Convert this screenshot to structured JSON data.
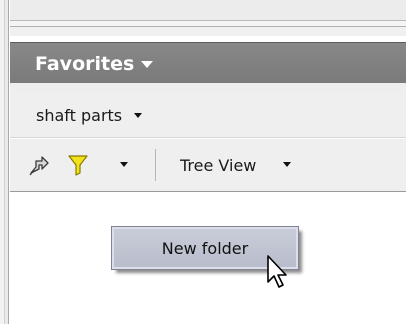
{
  "favorites": {
    "title": "Favorites"
  },
  "folder_selector": {
    "value": "shaft parts"
  },
  "toolbar": {
    "view_label": "Tree View"
  },
  "context_menu": {
    "items": [
      {
        "label": "New folder"
      }
    ]
  },
  "icons": {
    "collapse": "collapse-tree-icon",
    "filter": "filter-funnel-icon",
    "pointer": "mouse-pointer-icon"
  },
  "colors": {
    "header_bg": "#808080",
    "filter_yellow": "#f2e21c",
    "menu_bg": "#c4c7d4"
  }
}
